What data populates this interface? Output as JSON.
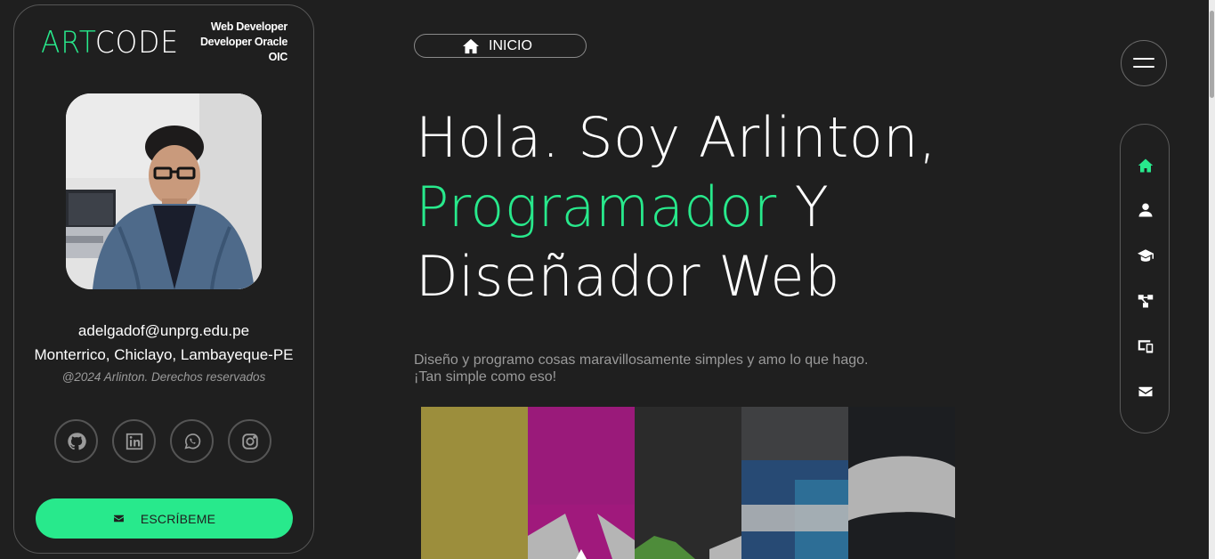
{
  "logo": {
    "part1": "ART",
    "part2": "CODE"
  },
  "roles": [
    "Web Developer",
    "Developer Oracle",
    "OIC"
  ],
  "profile": {
    "email": "adelgadof@unprg.edu.pe",
    "location": "Monterrico, Chiclayo, Lambayeque-PE",
    "copyright": "@2024 Arlinton. Derechos reservados"
  },
  "socials": [
    {
      "name": "github",
      "icon": "github-icon"
    },
    {
      "name": "linkedin",
      "icon": "linkedin-icon"
    },
    {
      "name": "whatsapp",
      "icon": "whatsapp-icon"
    },
    {
      "name": "instagram",
      "icon": "instagram-icon"
    }
  ],
  "cta": {
    "label": "ESCRÍBEME",
    "icon": "envelope-icon"
  },
  "badge": {
    "label": "INICIO",
    "icon": "home-icon"
  },
  "hero": {
    "line1": "Hola. Soy Arlinton,",
    "highlight": "Programador",
    "line2_rest": " Y",
    "line3": "Diseñador Web"
  },
  "intro": {
    "line1": "Diseño y programo cosas maravillosamente simples y amo lo que hago.",
    "line2": "¡Tan simple como eso!"
  },
  "sidenav": [
    {
      "name": "home",
      "icon": "home-icon",
      "active": true
    },
    {
      "name": "about",
      "icon": "user-icon",
      "active": false
    },
    {
      "name": "education",
      "icon": "graduation-cap-icon",
      "active": false
    },
    {
      "name": "skills",
      "icon": "network-icon",
      "active": false
    },
    {
      "name": "portfolio",
      "icon": "devices-icon",
      "active": false
    },
    {
      "name": "contact",
      "icon": "envelope-icon",
      "active": false
    }
  ],
  "colors": {
    "accent": "#28e98c",
    "background": "#1f1f1f",
    "muted": "#9a9a9a",
    "border": "#565656"
  }
}
